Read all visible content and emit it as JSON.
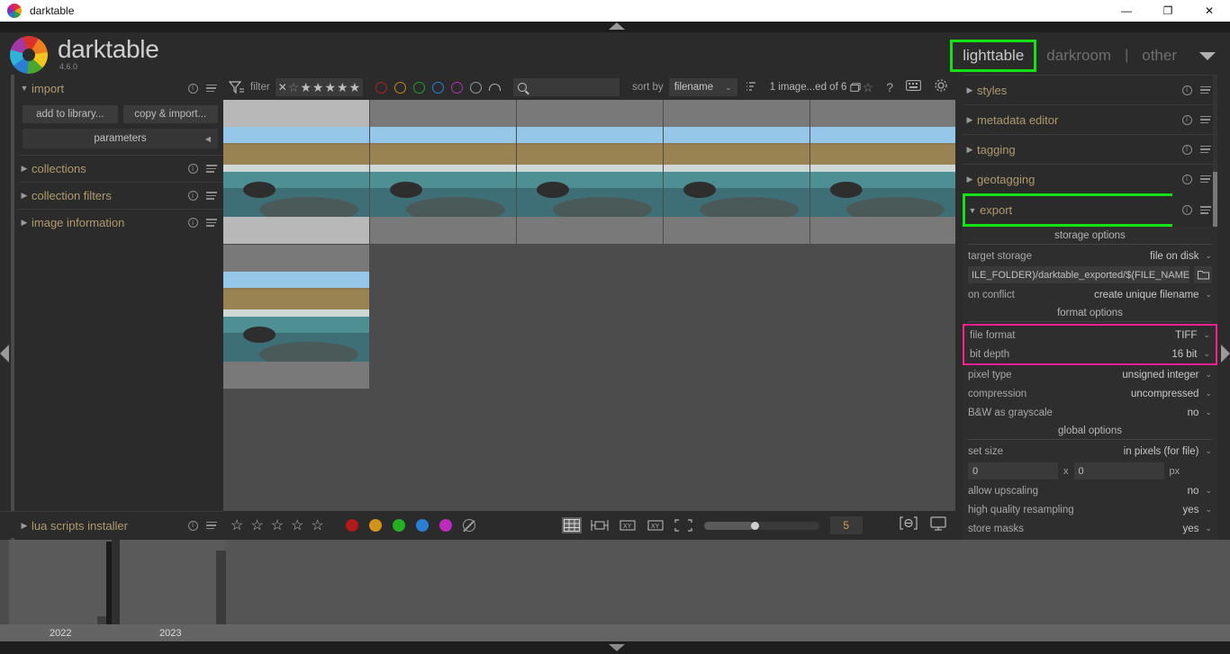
{
  "window": {
    "title": "darktable",
    "minimize": "—",
    "maximize": "❐",
    "close": "✕"
  },
  "brand": {
    "name": "darktable",
    "version": "4.6.0"
  },
  "views": {
    "items": [
      {
        "label": "lighttable",
        "active": true,
        "highlighted": true
      },
      {
        "label": "darkroom",
        "active": false,
        "highlighted": false
      },
      {
        "label": "other",
        "active": false,
        "highlighted": false
      }
    ],
    "separator": "|"
  },
  "left_panel": {
    "modules": [
      {
        "label": "import",
        "expanded": true
      },
      {
        "label": "collections",
        "expanded": false
      },
      {
        "label": "collection filters",
        "expanded": false
      },
      {
        "label": "image information",
        "expanded": false
      }
    ],
    "import": {
      "add_to_library": "add to library...",
      "copy_import": "copy & import...",
      "parameters": "parameters"
    },
    "lua": {
      "label": "lua scripts installer",
      "expanded": false
    }
  },
  "toolbar": {
    "filter_label": "filter",
    "stars": [
      "✕",
      "☆",
      "★",
      "★",
      "★",
      "★",
      "★"
    ],
    "color_filters": [
      "#b02020",
      "#c08a10",
      "#20a020",
      "#2a7fd4",
      "#b030b0",
      "#9a9a9a"
    ],
    "search_placeholder": "",
    "sort_by_label": "sort by",
    "sort_value": "filename",
    "image_count": "1 image...ed of 6"
  },
  "bottom_toolbar": {
    "stars": [
      "☆",
      "☆",
      "☆",
      "☆",
      "☆"
    ],
    "color_labels": [
      "#b01a1a",
      "#d09418",
      "#23b023",
      "#2a7fd4",
      "#bb2cbb"
    ],
    "zoom_value": "5"
  },
  "right_panel": {
    "modules": [
      {
        "label": "styles",
        "expanded": false,
        "highlighted": false
      },
      {
        "label": "metadata editor",
        "expanded": false,
        "highlighted": false
      },
      {
        "label": "tagging",
        "expanded": false,
        "highlighted": false
      },
      {
        "label": "geotagging",
        "expanded": false,
        "highlighted": false
      },
      {
        "label": "export",
        "expanded": true,
        "highlighted": true
      }
    ],
    "export": {
      "storage_options_title": "storage options",
      "target_storage_label": "target storage",
      "target_storage_value": "file on disk",
      "path_value": "ILE_FOLDER)/darktable_exported/$(FILE_NAME)",
      "on_conflict_label": "on conflict",
      "on_conflict_value": "create unique filename",
      "format_options_title": "format options",
      "file_format_label": "file format",
      "file_format_value": "TIFF",
      "bit_depth_label": "bit depth",
      "bit_depth_value": "16 bit",
      "pixel_type_label": "pixel type",
      "pixel_type_value": "unsigned integer",
      "compression_label": "compression",
      "compression_value": "uncompressed",
      "bw_grayscale_label": "B&W as grayscale",
      "bw_grayscale_value": "no",
      "global_options_title": "global options",
      "set_size_label": "set size",
      "set_size_value": "in pixels (for file)",
      "width_value": "0",
      "height_value": "0",
      "size_separator": "x",
      "size_unit": "px",
      "allow_upscaling_label": "allow upscaling",
      "allow_upscaling_value": "no",
      "hq_resampling_label": "high quality resampling",
      "hq_resampling_value": "yes",
      "store_masks_label": "store masks",
      "store_masks_value": "yes"
    }
  },
  "timeline": {
    "years": [
      "2022",
      "2023"
    ]
  },
  "highlight_colors": {
    "green": "#15e215",
    "magenta": "#ff1f8f"
  },
  "thumbnails": [
    {
      "selected": true
    },
    {
      "selected": false
    },
    {
      "selected": false
    },
    {
      "selected": false
    },
    {
      "selected": false
    },
    {
      "selected": false
    }
  ]
}
